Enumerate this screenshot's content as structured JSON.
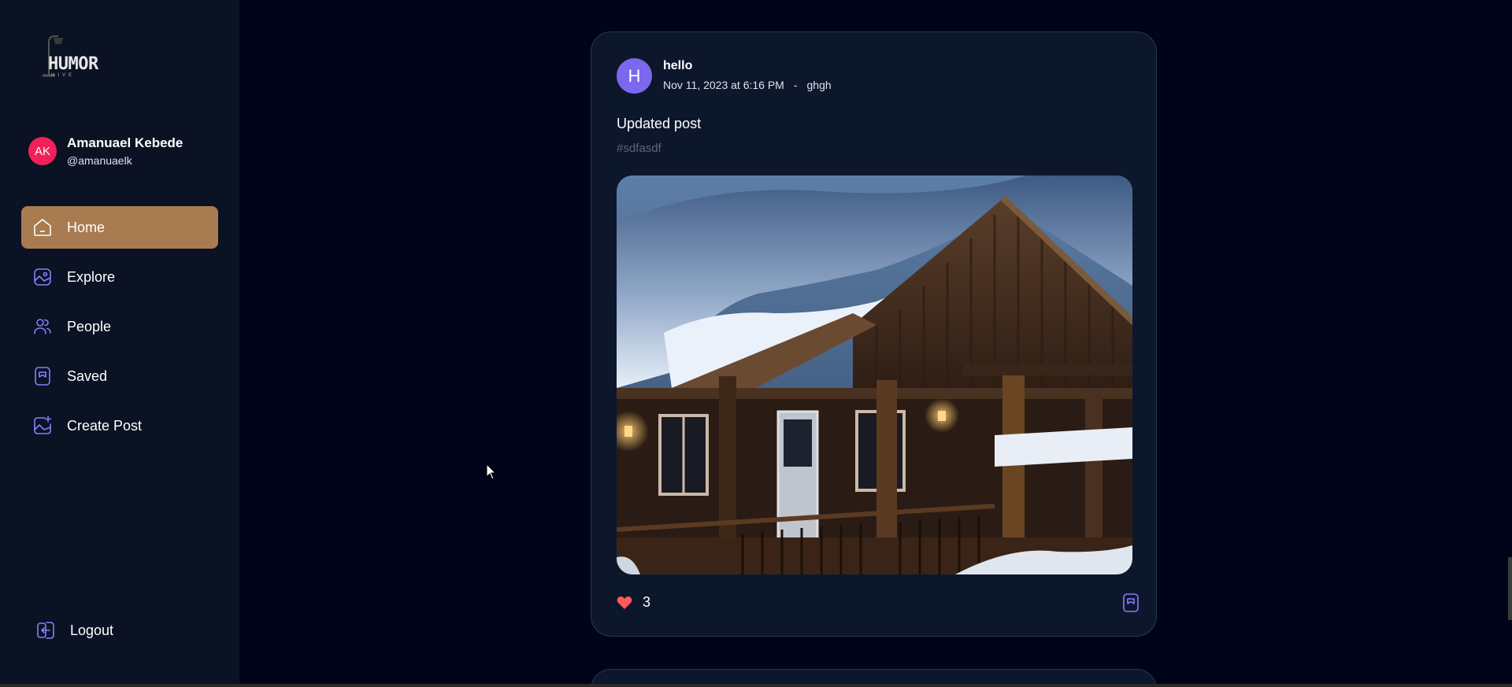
{
  "brand": {
    "name": "HUMOR",
    "sub": "HIVE"
  },
  "user": {
    "initials": "AK",
    "name": "Amanuael Kebede",
    "handle": "@amanuaelk"
  },
  "nav": [
    {
      "label": "Home",
      "icon": "home-icon",
      "active": true
    },
    {
      "label": "Explore",
      "icon": "gallery-icon"
    },
    {
      "label": "People",
      "icon": "people-icon"
    },
    {
      "label": "Saved",
      "icon": "bookmark-icon"
    },
    {
      "label": "Create Post",
      "icon": "add-image-icon"
    }
  ],
  "logout": {
    "label": "Logout",
    "icon": "logout-icon"
  },
  "post": {
    "avatar_initial": "H",
    "author": "hello",
    "date": "Nov 11, 2023 at 6:16 PM",
    "separator": "-",
    "location": "ghgh",
    "caption": "Updated post",
    "tag": "#sdfasdf",
    "likes": "3"
  },
  "colors": {
    "active_nav": "#a87c50",
    "accent_icon": "#877eff",
    "like": "#ff5a5a",
    "avatar_user": "#f0215a",
    "avatar_post": "#7b68ee"
  }
}
